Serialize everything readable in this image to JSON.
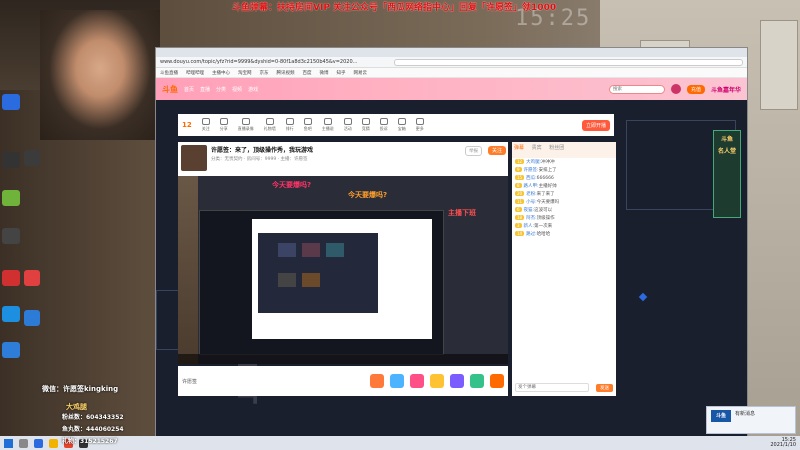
{
  "banner": {
    "text": "斗鱼弹幕：扶持房间VIP 关注公众号「西瓜网络指中心」回复「许愿签」领1000"
  },
  "clock": "15:25",
  "browser": {
    "url": "www.douyu.com/topic/yfz?rid=9999&dyshid=0-80f1a8d3c2150b45&v=2020...",
    "bookmarks": [
      "斗鱼直播",
      "哔哩哔哩",
      "主播中心",
      "淘宝网",
      "京东",
      "腾讯视频",
      "百度",
      "微博",
      "知乎",
      "网易云"
    ]
  },
  "site": {
    "logo": "斗鱼",
    "nav": [
      "首页",
      "直播",
      "分类",
      "视频",
      "游戏"
    ],
    "search_placeholder": "搜索",
    "head_button": "充值",
    "promo": "斗鱼嘉年华"
  },
  "toolbar": {
    "level": "12",
    "items": [
      "关注",
      "分享",
      "直播录像",
      "礼物墙",
      "排行",
      "鱼吧",
      "主播说",
      "活动",
      "竞猜",
      "投诉",
      "宝箱",
      "更多"
    ],
    "open_button": "立即开播"
  },
  "stream": {
    "title": "许愿签：来了，顶级操作秀，我玩游戏",
    "subtitle": "分类：无畏契约  ·  房间号：9999  ·  主播：许愿签",
    "follow": "关注",
    "report": "举报"
  },
  "overlay": {
    "line1": "今天要爆吗?",
    "line2": "今天要爆吗?",
    "line3": "主播下班"
  },
  "gift_bar": {
    "label": "许愿签",
    "gifts": [
      "#ff7a3a",
      "#4bb3ff",
      "#ff4f87",
      "#ffc233",
      "#7a5cff",
      "#35c28a",
      "#ff6a00"
    ]
  },
  "chat": {
    "tabs": [
      "弹幕",
      "贵宾",
      "粉丝团"
    ],
    "lines": [
      {
        "badge": "12",
        "name": "大鸡腿:",
        "text": "冲冲冲"
      },
      {
        "badge": "9",
        "name": "许愿签:",
        "text": "安排上了"
      },
      {
        "badge": "15",
        "name": "西瓜:",
        "text": "666666"
      },
      {
        "badge": "8",
        "name": "路人甲:",
        "text": "主播好帅"
      },
      {
        "badge": "20",
        "name": "老粉:",
        "text": "来了来了"
      },
      {
        "badge": "11",
        "name": "小号:",
        "text": "今天要爆吗"
      },
      {
        "badge": "6",
        "name": "夜猫:",
        "text": "这波可以"
      },
      {
        "badge": "18",
        "name": "阿杰:",
        "text": "顶级操作"
      },
      {
        "badge": "3",
        "name": "新人:",
        "text": "第一次来"
      },
      {
        "badge": "14",
        "name": "路过:",
        "text": "哈哈哈"
      }
    ],
    "input_placeholder": "发个弹幕",
    "send": "发送"
  },
  "side_rank": [
    "斗鱼",
    "名人堂"
  ],
  "obs": {
    "name": "微信：许愿签kingking",
    "title": "大鸡腿",
    "stats": [
      "粉丝数：604343352",
      "鱼丸数：444060254",
      "礼物：315215267"
    ]
  },
  "notification": {
    "logo": "斗鱼",
    "text": "有新消息"
  },
  "taskbar": {
    "time": "15:25",
    "date": "2021/1/10"
  }
}
